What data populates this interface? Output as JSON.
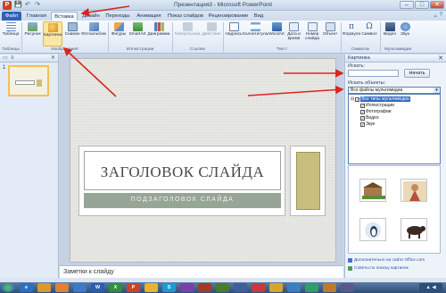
{
  "window": {
    "title": "Презентация3 - Microsoft PowerPoint",
    "app_letter": "P"
  },
  "quick_access": {
    "save": "💾",
    "undo": "↶",
    "redo": "↷"
  },
  "window_controls": {
    "minimize": "–",
    "maximize": "□",
    "close": "✕"
  },
  "tabs": {
    "file": "Файл",
    "home": "Главная",
    "insert": "Вставка",
    "design": "Дизайн",
    "transitions": "Переходы",
    "animation": "Анимация",
    "slideshow": "Показ слайдов",
    "review": "Рецензирование",
    "view": "Вид"
  },
  "ribbon": {
    "table": "Таблица",
    "picture": "Рисунок",
    "clipart": "Картинка",
    "screenshot": "Снимок",
    "album": "Фотоальбом",
    "shapes": "Фигуры",
    "smartart": "SmartArt",
    "chart": "Диаграмма",
    "hyperlink": "Гиперссылка",
    "action": "Действие",
    "textbox": "Надпись",
    "header": "Колонтитулы",
    "wordart": "WordArt",
    "datetime": "Дата и время",
    "slidenum": "Номер слайда",
    "object": "Объект",
    "equation": "Формула",
    "symbol": "Символ",
    "video": "Видео",
    "audio": "Звук",
    "groups": {
      "tables": "Таблицы",
      "images": "Изображения",
      "illustrations": "Иллюстрации",
      "links": "Ссылки",
      "text": "Текст",
      "symbols": "Символы",
      "media": "Мультимедиа"
    }
  },
  "slides_panel": {
    "slide_number": "1"
  },
  "slide": {
    "title": "ЗАГОЛОВОК СЛАЙДА",
    "subtitle": "ПОДЗАГОЛОВОК СЛАЙДА"
  },
  "notes": {
    "placeholder": "Заметки к слайду"
  },
  "clipart_pane": {
    "title": "Картинка",
    "search_label": "Искать:",
    "search_value": "",
    "go_button": "Начать",
    "objects_label": "Искать объекты:",
    "objects_selected": "Все файлы мультимедиа",
    "media_types": [
      "Все типы мультимедиа",
      "Иллюстрации",
      "Фотографии",
      "Видео",
      "Звук"
    ],
    "link_office": "Дополнительно на сайте Office.com",
    "link_tips": "Советы по поиску картинок"
  },
  "colors": {
    "accent": "#2f62b8",
    "arrow": "#d9261c",
    "subtitle_band": "#96a596",
    "side_box": "#c9bf7c"
  }
}
